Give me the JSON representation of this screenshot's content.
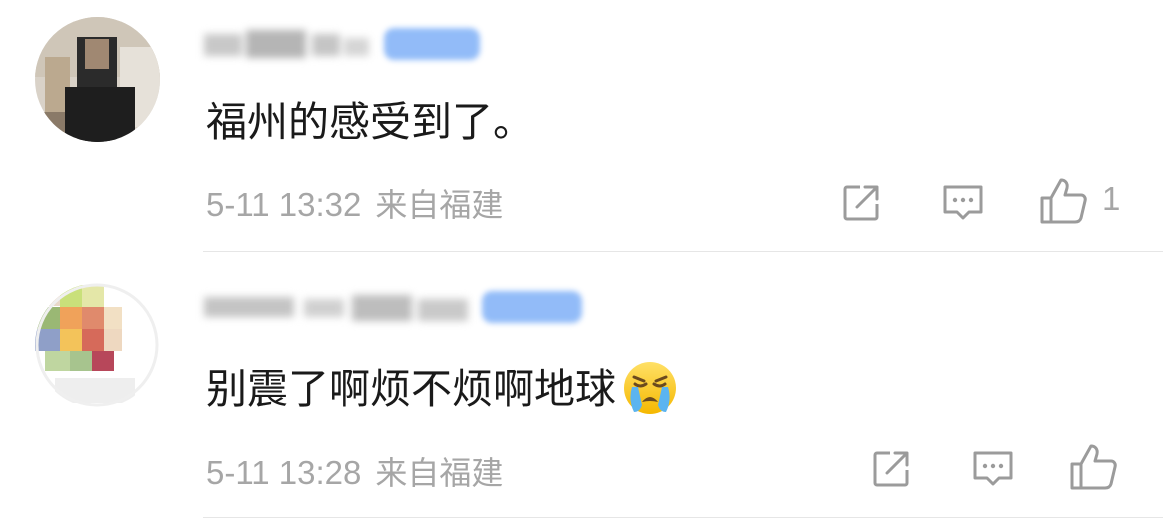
{
  "comments": [
    {
      "content": "福州的感受到了。",
      "time": "5-11 13:32",
      "location": "来自福建",
      "like_count": "1"
    },
    {
      "content": "别震了啊烦不烦啊地球",
      "emoji": "loudly-crying-face",
      "time": "5-11 13:28",
      "location": "来自福建",
      "like_count": ""
    }
  ],
  "icons": {
    "share": "share-icon",
    "reply": "comment-icon",
    "like": "thumbs-up-icon"
  },
  "colors": {
    "text": "#1a1a1a",
    "meta": "#a6a6a6",
    "icon": "#9b9b9b",
    "badge": "#7fb0f7",
    "divider": "#e6e6e6"
  }
}
